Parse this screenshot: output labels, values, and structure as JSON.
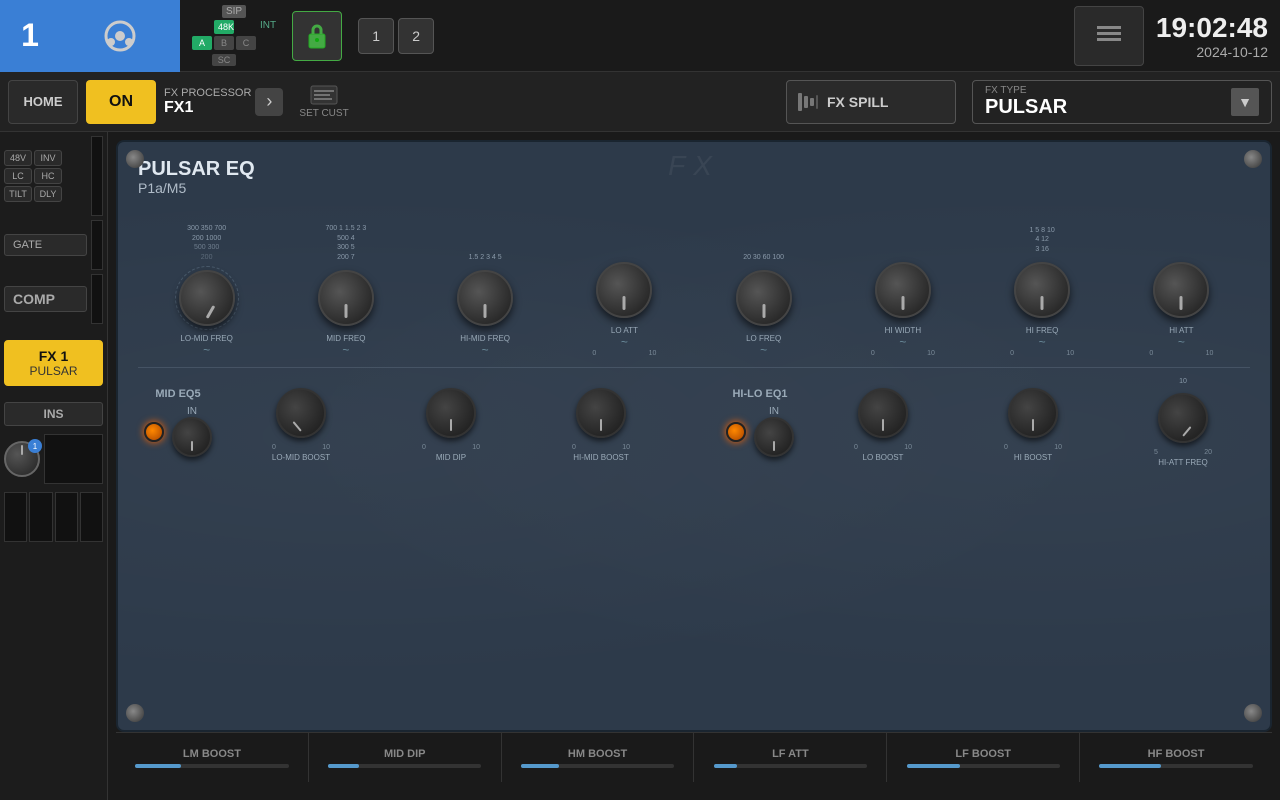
{
  "topbar": {
    "channel_number": "1",
    "sip_label": "SIP",
    "rate_48k": "48K",
    "rate_int": "INT",
    "rate_a": "A",
    "rate_b": "B",
    "rate_c": "C",
    "sc_label": "SC",
    "monitor1": "1",
    "monitor2": "2",
    "tools_label": "TOOLS",
    "time": "19:02:48",
    "date": "2024-10-12"
  },
  "secondbar": {
    "home_label": "HOME",
    "on_label": "ON",
    "fx_processor_label": "FX PROCESSOR",
    "fx_processor_name": "FX1",
    "set_cust_label": "SET CUST",
    "fx_type_label": "FX TYPE",
    "fx_type_name": "PULSAR",
    "fx_spill_label": "FX SPILL"
  },
  "fx_panel": {
    "title": "PULSAR EQ",
    "subtitle": "P1a/M5",
    "watermark": "FX",
    "knobs_row1": [
      {
        "label": "LO-MID FREQ",
        "scales": [
          "200",
          "300",
          "500",
          "700",
          "700",
          "1000",
          "500",
          "300",
          "200"
        ],
        "range_low": "",
        "range_high": ""
      },
      {
        "label": "MID FREQ",
        "scales": [
          "700",
          "1",
          "1.5",
          "2",
          "3",
          "500",
          "4",
          "300",
          "5",
          "200",
          "7"
        ],
        "range_low": "",
        "range_high": ""
      },
      {
        "label": "HI-MID FREQ",
        "scales": [
          "1.5",
          "2",
          "3",
          "4",
          "5"
        ],
        "range_low": "",
        "range_high": ""
      },
      {
        "label": "LO ATT",
        "scales": [],
        "range_low": "0",
        "range_high": "10"
      },
      {
        "label": "LO FREQ",
        "scales": [
          "20",
          "30",
          "60",
          "100"
        ],
        "range_low": "",
        "range_high": ""
      },
      {
        "label": "HI WIDTH",
        "scales": [],
        "range_low": "0",
        "range_high": "10"
      },
      {
        "label": "HI FREQ",
        "scales": [
          "1",
          "5",
          "8",
          "10",
          "4",
          "12",
          "3",
          "16"
        ],
        "range_low": "0",
        "range_high": "10"
      },
      {
        "label": "HI ATT",
        "scales": [],
        "range_low": "0",
        "range_high": "10"
      }
    ],
    "section2_title": "MID EQ5",
    "section2_in": "IN",
    "section3_title": "HI-LO EQ1",
    "section3_in": "IN",
    "knobs_row2": [
      {
        "label": "LO-MID BOOST",
        "range_low": "0",
        "range_high": "10"
      },
      {
        "label": "MID DIP",
        "range_low": "0",
        "range_high": "10"
      },
      {
        "label": "HI-MID BOOST",
        "range_low": "0",
        "range_high": "10"
      },
      {
        "label": "LO BOOST",
        "range_low": "0",
        "range_high": "10"
      },
      {
        "label": "HI BOOST",
        "range_low": "0",
        "range_high": "10"
      },
      {
        "label": "HI-ATT FREQ",
        "range_low": "5",
        "range_high": "20"
      }
    ]
  },
  "sidebar": {
    "btn_48v": "48V",
    "btn_inv": "INV",
    "btn_lc": "LC",
    "btn_hc": "HC",
    "btn_tilt": "TILT",
    "btn_dly": "DLY",
    "gate_label": "GATE",
    "comp_label": "COMP",
    "fx1_label": "FX 1",
    "fx1_sub": "PULSAR",
    "ins_label": "INS"
  },
  "bottom_params": [
    {
      "label": "LM BOOST",
      "fill": 0.3
    },
    {
      "label": "MID DIP",
      "fill": 0.2
    },
    {
      "label": "HM BOOST",
      "fill": 0.25
    },
    {
      "label": "LF ATT",
      "fill": 0.15
    },
    {
      "label": "LF BOOST",
      "fill": 0.35
    },
    {
      "label": "HF BOOST",
      "fill": 0.4
    }
  ]
}
